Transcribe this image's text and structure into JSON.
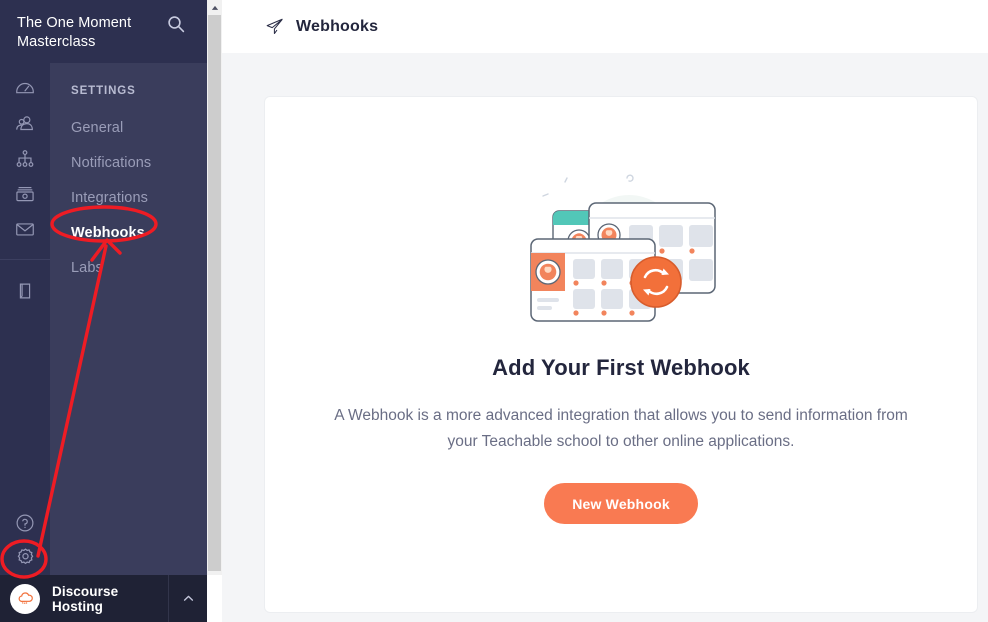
{
  "colors": {
    "sidebar_bg": "#2d3050",
    "submenu_bg": "#3a3d5c",
    "userbar_bg": "#1f2235",
    "main_bg": "#f4f5f7",
    "card_bg": "#ffffff",
    "accent_orange": "#f97a52",
    "annotation_red": "#ee1c24",
    "active_text": "#ffffff",
    "muted_text": "#9a9db8"
  },
  "sidebar": {
    "brand_title": "The One Moment Masterclass",
    "search_icon": "search-icon",
    "rail_icons": [
      {
        "name": "dashboard-gauge-icon",
        "label": "Dashboard"
      },
      {
        "name": "users-icon",
        "label": "Users"
      },
      {
        "name": "sitemap-icon",
        "label": "Site Structure"
      },
      {
        "name": "sales-card-icon",
        "label": "Sales"
      },
      {
        "name": "envelope-icon",
        "label": "Emails"
      },
      {
        "name": "book-icon",
        "label": "Library"
      }
    ],
    "rail_bottom_icons": [
      {
        "name": "help-circle-icon",
        "label": "Help"
      },
      {
        "name": "gear-icon",
        "label": "Settings"
      }
    ],
    "submenu": {
      "header": "SETTINGS",
      "items": [
        {
          "label": "General",
          "active": false
        },
        {
          "label": "Notifications",
          "active": false
        },
        {
          "label": "Integrations",
          "active": false
        },
        {
          "label": "Webhooks",
          "active": true
        },
        {
          "label": "Labs",
          "active": false
        }
      ]
    },
    "user": {
      "name": "Discourse Hosting",
      "avatar_icon": "cloud-avatar-icon",
      "chevron_icon": "chevron-up-icon"
    }
  },
  "scrollbar": {
    "up_arrow_icon": "chevron-up-icon",
    "orientation": "vertical"
  },
  "topbar": {
    "icon": "paper-plane-icon",
    "title": "Webhooks"
  },
  "main": {
    "illustration": "webhook-sync-cards-illustration",
    "empty_title": "Add Your First Webhook",
    "empty_description": "A Webhook is a more advanced integration that allows you to send information from your Teachable school to other online applications.",
    "cta_label": "New Webhook"
  },
  "annotations": {
    "ellipse_webhooks": "red-ellipse-around-webhooks",
    "ellipse_gear": "red-ellipse-around-gear-icon",
    "arrow": "red-arrow-from-gear-to-webhooks"
  }
}
